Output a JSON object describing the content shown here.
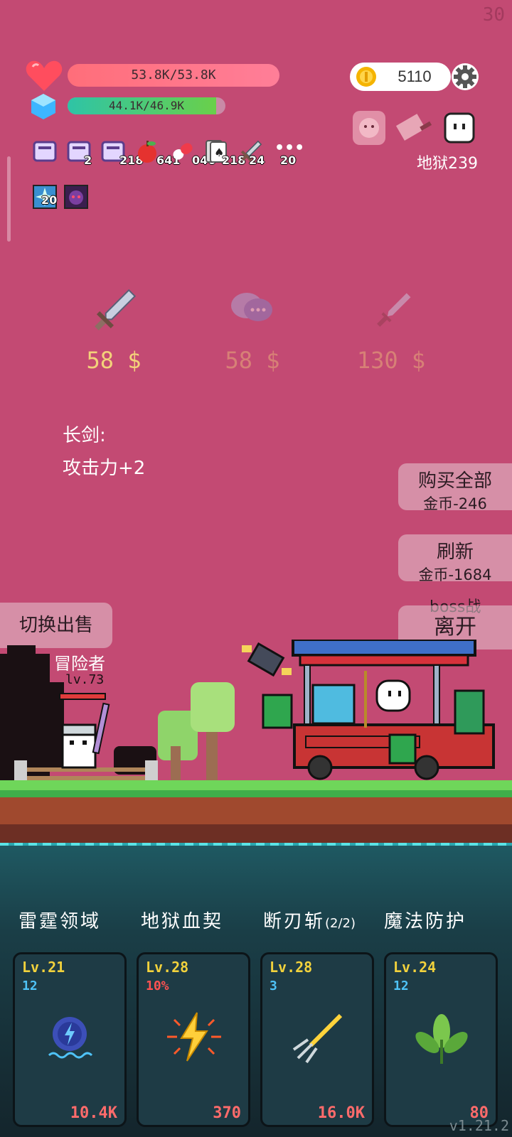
{
  "fps": "30",
  "hp": {
    "text": "53.8K/53.8K",
    "fraction": 1.0
  },
  "mp": {
    "text": "44.1K/46.9K",
    "fraction": 0.94
  },
  "coins": "5110",
  "hell_level": "地狱239",
  "inventory": [
    {
      "icon": "scroll-icon",
      "count": ""
    },
    {
      "icon": "scroll-icon",
      "count": "2"
    },
    {
      "icon": "scroll-icon",
      "count": "218"
    },
    {
      "icon": "apple-icon",
      "count": "641"
    },
    {
      "icon": "pill-icon",
      "count": "046"
    },
    {
      "icon": "card-icon",
      "count": "218"
    },
    {
      "icon": "sword-icon",
      "count": "24"
    },
    {
      "icon": "more-icon",
      "count": "20"
    }
  ],
  "buffs": [
    {
      "icon": "sparkle-buff-icon",
      "count": "20"
    },
    {
      "icon": "demon-buff-icon",
      "count": ""
    }
  ],
  "shop": [
    {
      "icon": "broadsword-icon",
      "price": "58 $",
      "active": true
    },
    {
      "icon": "speech-bubble-icon",
      "price": "58 $",
      "active": false
    },
    {
      "icon": "dagger-icon",
      "price": "130 $",
      "active": false
    }
  ],
  "selected_item": {
    "name": "长剑:",
    "desc": "攻击力+2"
  },
  "buttons": {
    "buy_all": "购买全部",
    "buy_all_cost": "金币-246",
    "refresh": "刷新",
    "refresh_cost": "金币-1684",
    "boss": "boss战",
    "leave": "离开",
    "switch_sell": "切换出售"
  },
  "player": {
    "name": "冒险者",
    "level": "lv.73"
  },
  "skills": [
    {
      "name": "雷霆领域",
      "suffix": "",
      "level": "Lv.21",
      "sub": "12",
      "sub_color": "#4fc3f7",
      "cost": "10.4K",
      "icon": "thunder-gear-icon"
    },
    {
      "name": "地狱血契",
      "suffix": "",
      "level": "Lv.28",
      "sub": "10%",
      "sub_color": "#ff5252",
      "cost": "370",
      "icon": "lightning-burst-icon"
    },
    {
      "name": "断刃斩",
      "suffix": "(2/2)",
      "level": "Lv.28",
      "sub": "3",
      "sub_color": "#4fc3f7",
      "cost": "16.0K",
      "icon": "trident-icon"
    },
    {
      "name": "魔法防护",
      "suffix": "",
      "level": "Lv.24",
      "sub": "12",
      "sub_color": "#4fc3f7",
      "cost": "80",
      "icon": "leaf-icon"
    }
  ],
  "version": "v1.21.2"
}
